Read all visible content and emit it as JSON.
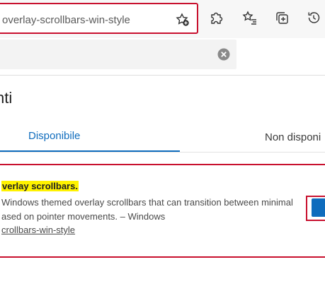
{
  "browser": {
    "address_bar": {
      "url_text": "overlay-scrollbars-win-style"
    },
    "icons": {
      "favorite_add": "star-plus-icon",
      "extensions": "puzzle-icon",
      "favorites": "star-list-icon",
      "collections": "collections-icon",
      "history": "history-icon"
    }
  },
  "search": {
    "clear_icon": "clear-circle-icon"
  },
  "page": {
    "title": "nti",
    "tabs": [
      {
        "label": "Disponibile",
        "selected": true
      },
      {
        "label": "Non disponi",
        "selected": false
      }
    ]
  },
  "flag": {
    "title": "verlay scrollbars.",
    "description_lines": [
      "Windows themed overlay scrollbars that can transition between minimal",
      "ased on pointer movements. – Windows"
    ],
    "link": "crollbars-win-style"
  },
  "colors": {
    "accent": "#0f6cbd",
    "highlight_box": "#c8102e",
    "search_highlight": "#fff200"
  }
}
